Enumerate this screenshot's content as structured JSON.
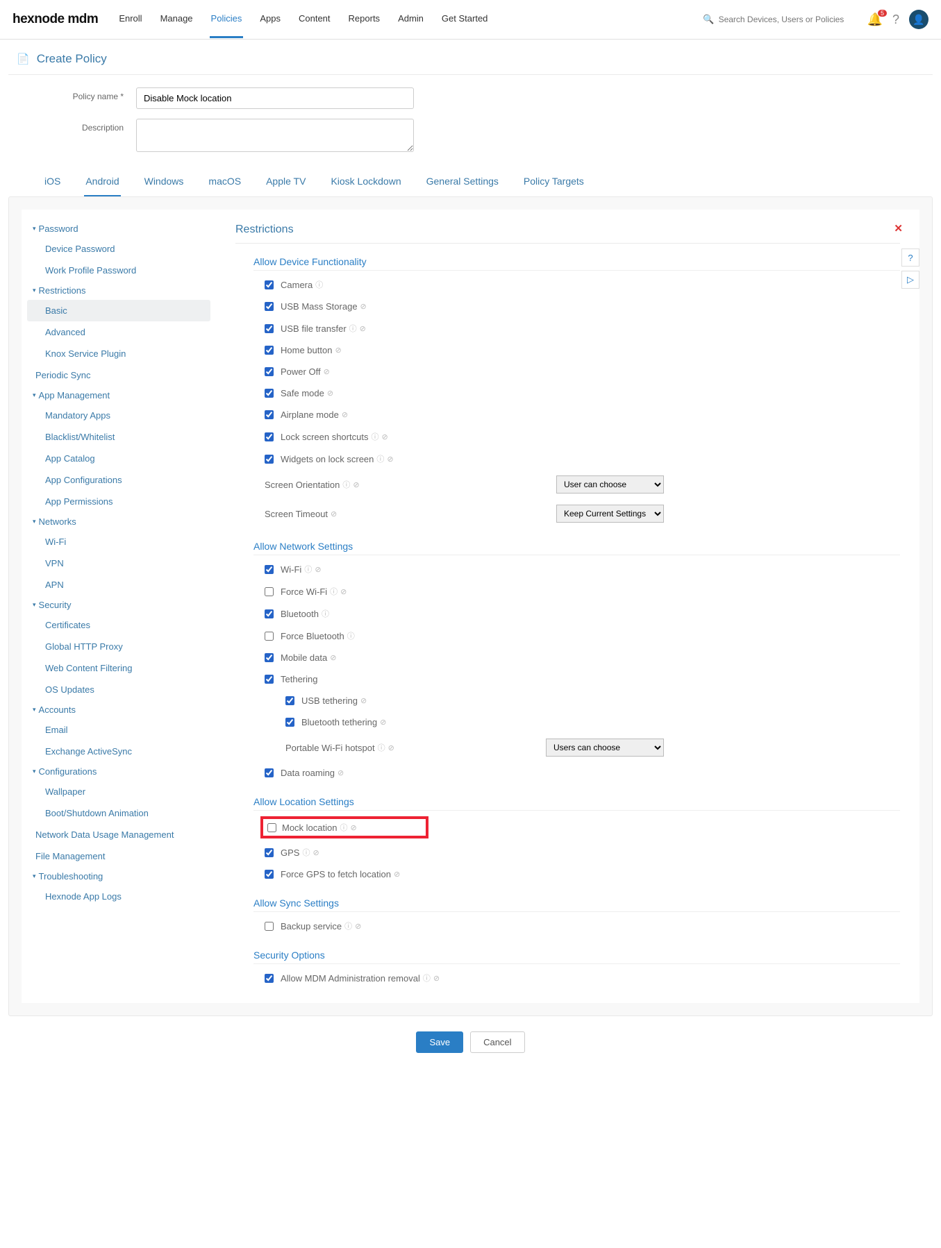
{
  "logo": "hexnode mdm",
  "nav": [
    "Enroll",
    "Manage",
    "Policies",
    "Apps",
    "Content",
    "Reports",
    "Admin",
    "Get Started"
  ],
  "nav_active": 2,
  "search_placeholder": "Search Devices, Users or Policies",
  "bell_badge": "5",
  "page_title": "Create Policy",
  "form": {
    "name_label": "Policy name *",
    "name_value": "Disable Mock location",
    "desc_label": "Description"
  },
  "tabs": [
    "iOS",
    "Android",
    "Windows",
    "macOS",
    "Apple TV",
    "Kiosk Lockdown",
    "General Settings",
    "Policy Targets"
  ],
  "tab_active": 1,
  "sidebar": [
    {
      "head": "Password",
      "items": [
        "Device Password",
        "Work Profile Password"
      ]
    },
    {
      "head": "Restrictions",
      "items": [
        "Basic",
        "Advanced",
        "Knox Service Plugin"
      ],
      "sel": 0
    },
    {
      "plain": "Periodic Sync"
    },
    {
      "head": "App Management",
      "items": [
        "Mandatory Apps",
        "Blacklist/Whitelist",
        "App Catalog",
        "App Configurations",
        "App Permissions"
      ]
    },
    {
      "head": "Networks",
      "items": [
        "Wi-Fi",
        "VPN",
        "APN"
      ]
    },
    {
      "head": "Security",
      "items": [
        "Certificates",
        "Global HTTP Proxy",
        "Web Content Filtering",
        "OS Updates"
      ]
    },
    {
      "head": "Accounts",
      "items": [
        "Email",
        "Exchange ActiveSync"
      ]
    },
    {
      "head": "Configurations",
      "items": [
        "Wallpaper",
        "Boot/Shutdown Animation"
      ]
    },
    {
      "plain": "Network Data Usage Management"
    },
    {
      "plain": "File Management"
    },
    {
      "head": "Troubleshooting",
      "items": [
        "Hexnode App Logs"
      ]
    }
  ],
  "main_title": "Restrictions",
  "sections": {
    "s1": {
      "title": "Allow Device Functionality",
      "items": [
        {
          "l": "Camera",
          "c": true,
          "i": 1
        },
        {
          "l": "USB Mass Storage",
          "c": true,
          "k": 1
        },
        {
          "l": "USB file transfer",
          "c": true,
          "i": 1,
          "k": 1
        },
        {
          "l": "Home button",
          "c": true,
          "k": 1
        },
        {
          "l": "Power Off",
          "c": true,
          "k": 1
        },
        {
          "l": "Safe mode",
          "c": true,
          "k": 1
        },
        {
          "l": "Airplane mode",
          "c": true,
          "k": 1
        },
        {
          "l": "Lock screen shortcuts",
          "c": true,
          "i": 1,
          "k": 1
        },
        {
          "l": "Widgets on lock screen",
          "c": true,
          "i": 1,
          "k": 1
        },
        {
          "l": "Screen Orientation",
          "sel": "User can choose",
          "i": 1,
          "k": 1
        },
        {
          "l": "Screen Timeout",
          "sel": "Keep Current Settings",
          "k": 1
        }
      ]
    },
    "s2": {
      "title": "Allow Network Settings",
      "items": [
        {
          "l": "Wi-Fi",
          "c": true,
          "i": 1,
          "k": 1
        },
        {
          "l": "Force Wi-Fi",
          "c": false,
          "i": 1,
          "k": 1
        },
        {
          "l": "Bluetooth",
          "c": true,
          "i": 1
        },
        {
          "l": "Force Bluetooth",
          "c": false,
          "i": 1
        },
        {
          "l": "Mobile data",
          "c": true,
          "k": 1
        },
        {
          "l": "Tethering",
          "c": true
        },
        {
          "l": "USB tethering",
          "c": true,
          "k": 1,
          "sub": true
        },
        {
          "l": "Bluetooth tethering",
          "c": true,
          "k": 1,
          "sub": true
        },
        {
          "l": "Portable Wi-Fi hotspot",
          "sel": "Users can choose",
          "i": 1,
          "k": 1,
          "sub": true,
          "selwide": true
        },
        {
          "l": "Data roaming",
          "c": true,
          "k": 1
        }
      ]
    },
    "s3": {
      "title": "Allow Location Settings",
      "items": [
        {
          "l": "Mock location",
          "c": false,
          "i": 1,
          "k": 1,
          "highlight": true
        },
        {
          "l": "GPS",
          "c": true,
          "i": 1,
          "k": 1
        },
        {
          "l": "Force GPS to fetch location",
          "c": true,
          "k": 1
        }
      ]
    },
    "s4": {
      "title": "Allow Sync Settings",
      "items": [
        {
          "l": "Backup service",
          "c": false,
          "i": 1,
          "k": 1
        }
      ]
    },
    "s5": {
      "title": "Security Options",
      "items": [
        {
          "l": "Allow MDM Administration removal",
          "c": true,
          "i": 1,
          "k": 1
        }
      ]
    }
  },
  "buttons": {
    "save": "Save",
    "cancel": "Cancel"
  }
}
